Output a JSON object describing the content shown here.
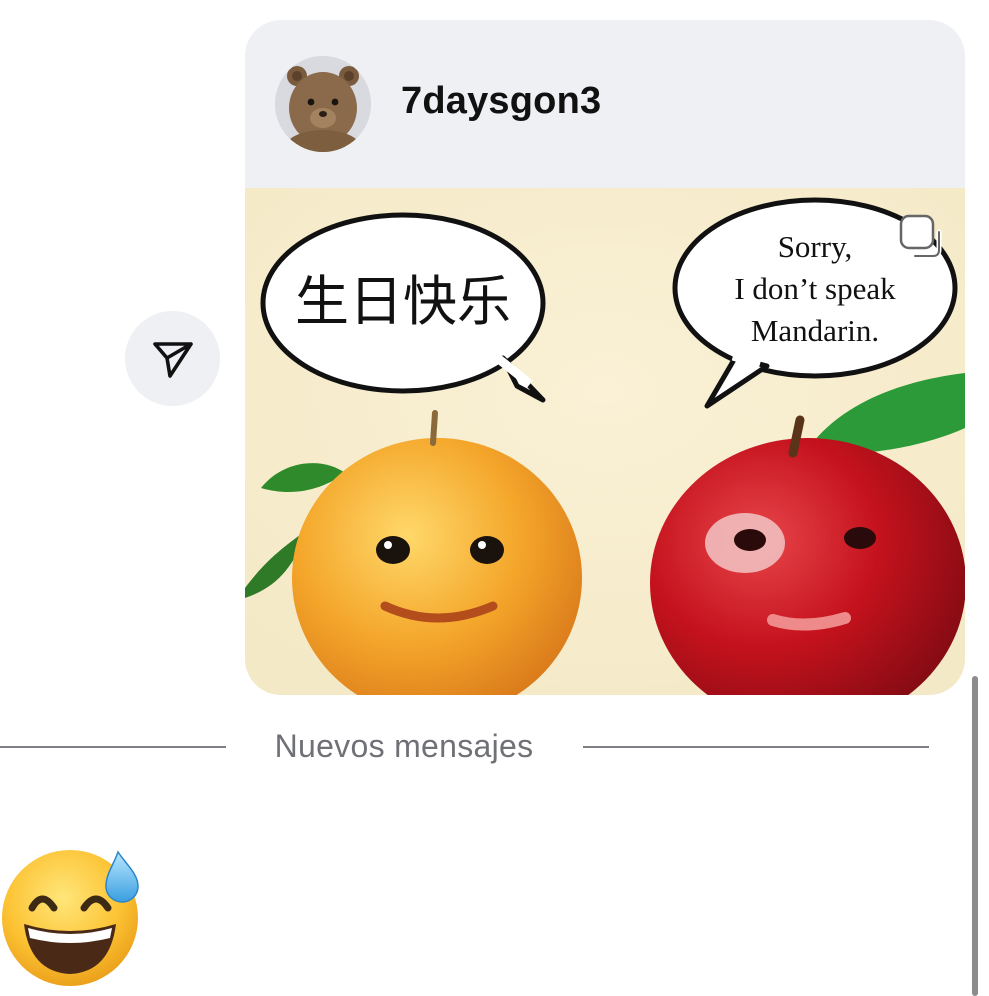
{
  "message": {
    "sender_username": "7daysgon3",
    "meme": {
      "left_bubble_text": "生日快乐",
      "right_bubble_lines": [
        "Sorry,",
        "I don’t speak",
        "Mandarin."
      ]
    }
  },
  "divider": {
    "label": "Nuevos mensajes"
  },
  "reaction": {
    "emoji": "grinning-face-with-sweat"
  },
  "icons": {
    "share": "send-icon",
    "story": "story-icon",
    "avatar": "bear-avatar"
  },
  "colors": {
    "card_bg": "#eff0f4",
    "text_primary": "#111111",
    "divider": "#7d7f85"
  }
}
